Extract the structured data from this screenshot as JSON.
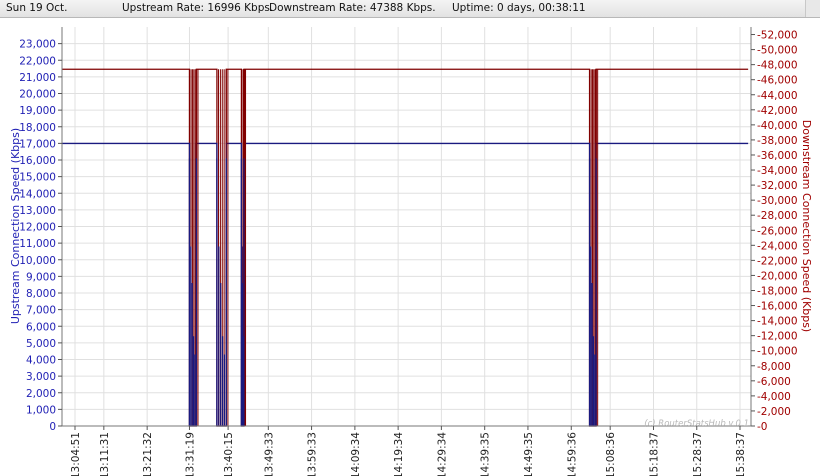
{
  "status": {
    "date": "Sun 19 Oct.",
    "upstream": "Upstream Rate: 16996 Kbps.",
    "downstream": "Downstream Rate: 47388 Kbps.",
    "uptime": "Uptime: 0 days, 00:38:11"
  },
  "colors": {
    "upstream": "#1a1a80",
    "downstream": "#800000",
    "grid": "#e0e0e0",
    "left_axis_text": "#1f1fb4",
    "right_axis_text": "#a00000"
  },
  "chart_data": {
    "type": "line",
    "title": "",
    "watermark": "(c) RouterStatsHub v.0.1",
    "x_tick_labels": [
      "13:04:51",
      "13:11:31",
      "13:21:32",
      "13:31:19",
      "13:40:15",
      "13:49:33",
      "13:59:33",
      "14:09:34",
      "14:19:34",
      "14:29:34",
      "14:39:35",
      "14:49:35",
      "14:59:36",
      "15:08:36",
      "15:18:37",
      "15:28:37",
      "15:38:37"
    ],
    "x_range": [
      "13:04:51",
      "15:40:30"
    ],
    "left_axis": {
      "label": "Upstream Connection Speed (Kbps)",
      "ylim": [
        0,
        24000
      ],
      "ticks": [
        0,
        1000,
        2000,
        3000,
        4000,
        5000,
        6000,
        7000,
        8000,
        9000,
        10000,
        11000,
        12000,
        13000,
        14000,
        15000,
        16000,
        17000,
        18000,
        19000,
        20000,
        21000,
        22000,
        23000
      ],
      "tick_labels": [
        "0",
        "1,000",
        "2,000",
        "3,000",
        "4,000",
        "5,000",
        "6,000",
        "7,000",
        "8,000",
        "9,000",
        "10,000",
        "11,000",
        "12,000",
        "13,000",
        "14,000",
        "15,000",
        "16,000",
        "17,000",
        "18,000",
        "19,000",
        "20,000",
        "21,000",
        "22,000",
        "23,000"
      ]
    },
    "right_axis": {
      "label": "Downstream Connection Speed (Kbps)",
      "ylim": [
        0,
        53000
      ],
      "ticks": [
        0,
        2000,
        4000,
        6000,
        8000,
        10000,
        12000,
        14000,
        16000,
        18000,
        20000,
        22000,
        24000,
        26000,
        28000,
        30000,
        32000,
        34000,
        36000,
        38000,
        40000,
        42000,
        44000,
        46000,
        48000,
        50000,
        52000
      ],
      "tick_labels": [
        "0",
        "2,000",
        "4,000",
        "6,000",
        "8,000",
        "10,000",
        "12,000",
        "14,000",
        "16,000",
        "18,000",
        "20,000",
        "22,000",
        "24,000",
        "26,000",
        "28,000",
        "30,000",
        "32,000",
        "34,000",
        "36,000",
        "38,000",
        "40,000",
        "42,000",
        "44,000",
        "46,000",
        "48,000",
        "50,000",
        "52,000"
      ]
    },
    "grid": true,
    "series": [
      {
        "name": "Upstream",
        "axis": "left",
        "baseline": 16996,
        "drops": [
          {
            "start": "13:31:19",
            "end": "13:32:55",
            "min": 0,
            "noise": [
              16100,
              10800,
              8600,
              5400,
              4300
            ]
          },
          {
            "start": "13:37:40",
            "end": "13:39:50",
            "min": 0,
            "noise": [
              16100,
              10800,
              8600,
              5400,
              4300
            ]
          },
          {
            "start": "13:43:20",
            "end": "13:43:55",
            "min": 0,
            "noise": [
              16100,
              10800,
              8600,
              5400,
              4300
            ]
          },
          {
            "start": "15:03:50",
            "end": "15:05:20",
            "min": 0,
            "noise": [
              16100,
              10800,
              8600,
              5400,
              4300
            ]
          }
        ]
      },
      {
        "name": "Downstream",
        "axis": "right",
        "baseline": 47388,
        "drops": [
          {
            "start": "13:31:19",
            "end": "13:32:55",
            "min": 0
          },
          {
            "start": "13:37:40",
            "end": "13:39:50",
            "min": 0
          },
          {
            "start": "13:43:20",
            "end": "13:43:55",
            "min": 0
          },
          {
            "start": "15:03:50",
            "end": "15:05:20",
            "min": 0
          }
        ]
      }
    ]
  }
}
